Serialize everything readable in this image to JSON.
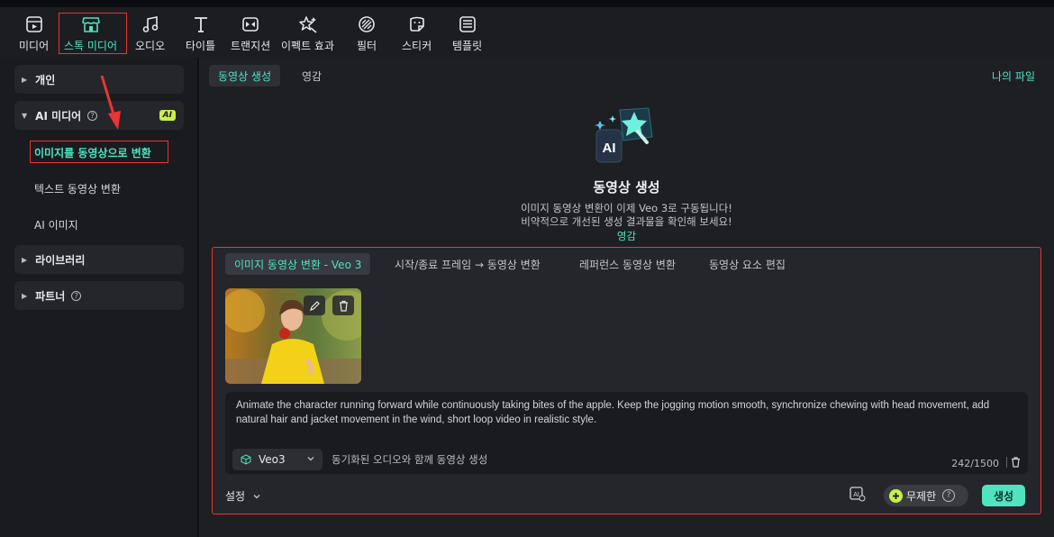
{
  "toolbar": {
    "items": [
      {
        "label": "미디어",
        "icon": "media-icon"
      },
      {
        "label": "스톡 미디어",
        "icon": "stock-media-icon"
      },
      {
        "label": "오디오",
        "icon": "audio-icon"
      },
      {
        "label": "타이틀",
        "icon": "title-icon"
      },
      {
        "label": "트랜지션",
        "icon": "transition-icon"
      },
      {
        "label": "이펙트 효과",
        "icon": "effects-icon"
      },
      {
        "label": "필터",
        "icon": "filter-icon"
      },
      {
        "label": "스티커",
        "icon": "sticker-icon"
      },
      {
        "label": "템플릿",
        "icon": "template-icon"
      }
    ],
    "active_index": 1
  },
  "sidebar": {
    "personal": "개인",
    "ai_media": "AI 미디어",
    "ai_badge": "AI",
    "sub_items": [
      "이미지를 동영상으로 변환",
      "텍스트 동영상 변환",
      "AI 이미지"
    ],
    "library": "라이브러리",
    "partner": "파트너"
  },
  "main": {
    "tabs": [
      "동영상 생성",
      "영감"
    ],
    "my_files": "나의 파일",
    "hero": {
      "title": "동영상 생성",
      "line1": "이미지 동영상 변환이 이제 Veo 3로 구동됩니다!",
      "line2": "비약적으로 개선된 생성 결과물을 확인해 보세요!",
      "link": "영감"
    },
    "panel": {
      "tabs": [
        "이미지 동영상 변환 - Veo 3",
        "시작/종료 프레임 → 동영상 변환",
        "레퍼런스 동영상 변환",
        "동영상 요소 편집"
      ],
      "prompt": "Animate the character running forward while continuously taking bites of the apple. Keep the jogging motion smooth, synchronize chewing with head movement, add natural hair and jacket movement in the wind, short loop video in realistic style.",
      "model": "Veo3",
      "model_note": "동기화된 오디오와 함께 동영상 생성",
      "count": "242/1500",
      "settings": "설정",
      "unlimited": "무제한",
      "generate": "생성"
    }
  },
  "colors": {
    "accent": "#4fe3c1",
    "annotation": "#ee3333",
    "badge": "#c8f04a"
  }
}
